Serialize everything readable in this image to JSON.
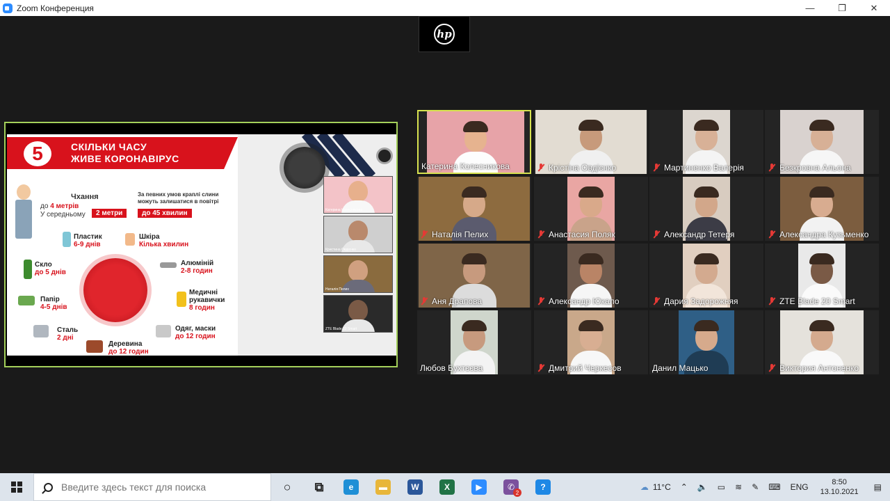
{
  "window": {
    "title": "Zoom Конференция",
    "minimize_glyph": "—",
    "maximize_glyph": "❐",
    "close_glyph": "✕"
  },
  "webcam_overlay": {
    "logo_text": "hp"
  },
  "shared_slide": {
    "number": "5",
    "title_line1": "СКІЛЬКИ ЧАСУ",
    "title_line2": "ЖИВЕ КОРОНАВІРУС",
    "sneeze_title": "Чхання",
    "sneeze_dist_prefix": "до ",
    "sneeze_dist": "4 метрів",
    "sneeze_avg": "У середньому",
    "sneeze_avg_value": "2 метри",
    "air_text_line1": "За певних умов краплі слини",
    "air_text_line2": "можуть залишатися в повітрі",
    "air_value": "до 45 хвилин",
    "items": [
      {
        "name": "Пластик",
        "time": "6-9 днів"
      },
      {
        "name": "Шкіра",
        "time": "Кілька хвилин"
      },
      {
        "name": "Скло",
        "time": "до 5 днів"
      },
      {
        "name": "Алюміній",
        "time": "2-8 годин"
      },
      {
        "name": "Папір",
        "time": "4-5 днів"
      },
      {
        "name": "Медичні рукавички",
        "time": "8 годин"
      },
      {
        "name": "Сталь",
        "time": "2 дні"
      },
      {
        "name": "Одяг, маски",
        "time": "до 12 годин"
      },
      {
        "name": "Деревина",
        "time": "до 12 годин"
      }
    ],
    "thumbnails": [
      {
        "name": "Катерина Колесникова"
      },
      {
        "name": "Кристина Овдієнко"
      },
      {
        "name": "Наталія Пелих"
      },
      {
        "name": "ZTE Blade 20 Smart"
      }
    ]
  },
  "participants": [
    {
      "name": "Катерина Колесникова",
      "muted": false,
      "active": true
    },
    {
      "name": "Крістіна Овдієнко",
      "muted": true,
      "active": false
    },
    {
      "name": "Мартиненко Валерія",
      "muted": true,
      "active": false
    },
    {
      "name": "Безкровна Альона",
      "muted": true,
      "active": false
    },
    {
      "name": "Наталія Пелих",
      "muted": true,
      "active": false
    },
    {
      "name": "Анастасия Поляк",
      "muted": true,
      "active": false
    },
    {
      "name": "Александр Тетеря",
      "muted": true,
      "active": false
    },
    {
      "name": "Александра Кузьменко",
      "muted": true,
      "active": false
    },
    {
      "name": "Аня Драпова",
      "muted": true,
      "active": false
    },
    {
      "name": "Александр Юкало",
      "muted": true,
      "active": false
    },
    {
      "name": "Дария Задорожняя",
      "muted": true,
      "active": false
    },
    {
      "name": "ZTE Blade 20 Smart",
      "muted": true,
      "active": false
    },
    {
      "name": "Любов Бухтєєва",
      "muted": false,
      "active": false
    },
    {
      "name": "Дмитрий Черкесов",
      "muted": true,
      "active": false
    },
    {
      "name": "Данил Мацько",
      "muted": false,
      "active": false
    },
    {
      "name": "Виктория Антоненко",
      "muted": true,
      "active": false
    }
  ],
  "taskbar": {
    "search_placeholder": "Введите здесь текст для поиска",
    "apps": [
      {
        "icon": "task-view-icon",
        "glyph": "○"
      },
      {
        "icon": "timeline-icon",
        "glyph": "⧉"
      },
      {
        "icon": "edge-icon",
        "glyph": "e",
        "color": "#1f8fd6"
      },
      {
        "icon": "file-explorer-icon",
        "glyph": "▬",
        "color": "#e8b63a"
      },
      {
        "icon": "word-icon",
        "glyph": "W",
        "color": "#2b579a"
      },
      {
        "icon": "excel-icon",
        "glyph": "X",
        "color": "#217346"
      },
      {
        "icon": "zoom-icon",
        "glyph": "▶",
        "color": "#2d8cff"
      },
      {
        "icon": "viber-icon",
        "glyph": "✆",
        "color": "#7b519d",
        "badge": "2"
      },
      {
        "icon": "help-icon",
        "glyph": "?",
        "color": "#1e88e5"
      }
    ],
    "weather": "11°C",
    "language": "ENG",
    "time": "8:50",
    "date": "13.10.2021"
  }
}
